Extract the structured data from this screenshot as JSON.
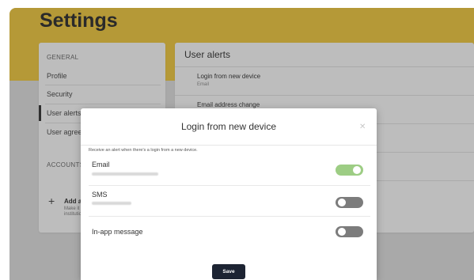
{
  "page": {
    "title": "Settings"
  },
  "sidebar": {
    "section_general": "GENERAL",
    "items": [
      {
        "label": "Profile"
      },
      {
        "label": "Security"
      },
      {
        "label": "User alerts"
      },
      {
        "label": "User agreements"
      }
    ],
    "section_accounts": "ACCOUNTS",
    "add": {
      "label": "Add account",
      "sub_1": "Make it easier to",
      "sub_2": "institution"
    }
  },
  "main": {
    "title": "User alerts",
    "rows": [
      {
        "label": "Login from new device",
        "sub": "Email"
      },
      {
        "label": "Email address change",
        "sub": ""
      }
    ]
  },
  "modal": {
    "title": "Login from new device",
    "close_icon": "close-icon",
    "description": "Receive an alert when there's a login from a new device.",
    "options": [
      {
        "label": "Email",
        "enabled": true
      },
      {
        "label": "SMS",
        "enabled": false
      },
      {
        "label": "In-app message",
        "enabled": false
      }
    ],
    "save_label": "Save"
  },
  "colors": {
    "banner": "#ecc53e",
    "toggle_on": "#9dcd84",
    "toggle_off": "#7c7c7c",
    "save_button": "#1d2433"
  }
}
